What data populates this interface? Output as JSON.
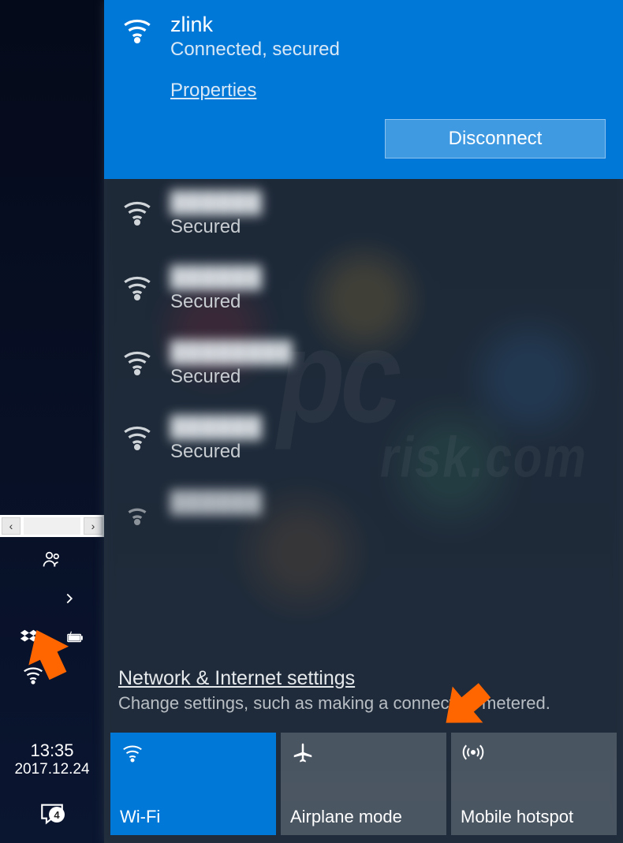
{
  "taskbar": {
    "time": "13:35",
    "date": "2017.12.24",
    "notification_count": "4"
  },
  "connected_network": {
    "name": "zlink",
    "status": "Connected, secured",
    "properties_label": "Properties",
    "disconnect_label": "Disconnect"
  },
  "available_networks": [
    {
      "name": "██████",
      "status": "Secured"
    },
    {
      "name": "██████",
      "status": "Secured"
    },
    {
      "name": "████████",
      "status": "Secured"
    },
    {
      "name": "██████",
      "status": "Secured"
    },
    {
      "name": "██████",
      "status": ""
    }
  ],
  "settings": {
    "link": "Network & Internet settings",
    "description": "Change settings, such as making a connection metered."
  },
  "tiles": {
    "wifi": "Wi-Fi",
    "airplane": "Airplane mode",
    "hotspot": "Mobile hotspot"
  }
}
